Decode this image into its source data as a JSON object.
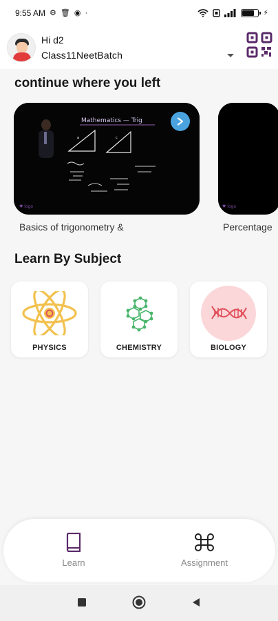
{
  "status_bar": {
    "time": "9:55 AM",
    "dot": "·"
  },
  "header": {
    "greeting": "Hi d2",
    "batch": "Class11NeetBatch",
    "avatar_icon": "user-avatar-icon",
    "qr_icon": "qr-code-icon"
  },
  "continue": {
    "title": "continue where you left",
    "videos": [
      {
        "caption": "Basics of trigonometry &"
      },
      {
        "caption": "Percentage"
      }
    ]
  },
  "subjects": {
    "title": "Learn By Subject",
    "items": [
      {
        "label": "PHYSICS",
        "icon": "atom-icon"
      },
      {
        "label": "CHEMISTRY",
        "icon": "molecule-icon"
      },
      {
        "label": "BIOLOGY",
        "icon": "dna-icon"
      }
    ]
  },
  "bottom_nav": {
    "items": [
      {
        "label": "Learn",
        "icon": "book-icon",
        "active": true
      },
      {
        "label": "Assignment",
        "icon": "command-icon",
        "active": false
      }
    ]
  },
  "colors": {
    "accent": "#5a2a6a",
    "physics": "#f2c14e",
    "chemistry": "#49b56b",
    "biology": "#e0505a",
    "play": "#4aa3df"
  }
}
